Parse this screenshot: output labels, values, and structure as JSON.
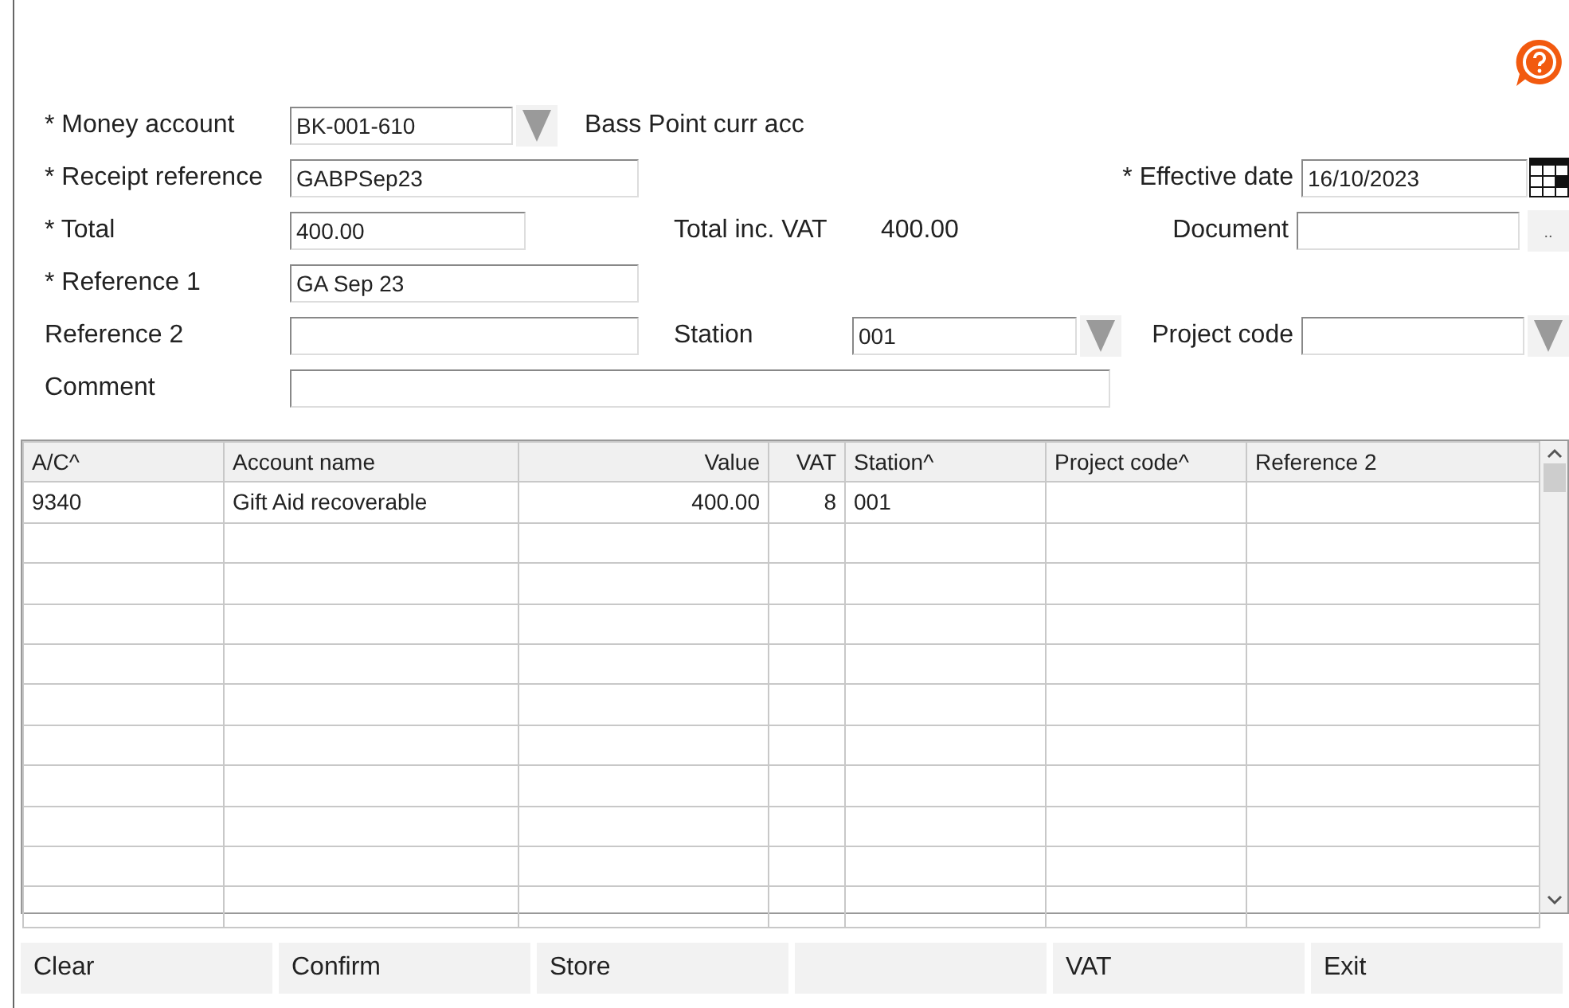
{
  "form": {
    "money_account": {
      "label": "* Money account",
      "value": "BK-001-610",
      "description": "Bass Point curr acc"
    },
    "receipt_reference": {
      "label": "* Receipt reference",
      "value": "GABPSep23"
    },
    "effective_date": {
      "label": "* Effective date",
      "value": "16/10/2023"
    },
    "total": {
      "label": "* Total",
      "value": "400.00"
    },
    "total_inc_vat": {
      "label": "Total inc. VAT",
      "value": "400.00"
    },
    "document": {
      "label": "Document",
      "button": ".."
    },
    "reference_1": {
      "label": "* Reference 1",
      "value": "GA Sep 23"
    },
    "reference_2": {
      "label": "Reference 2"
    },
    "station": {
      "label": "Station",
      "value": "001"
    },
    "project_code": {
      "label": "Project code"
    },
    "comment": {
      "label": "Comment"
    }
  },
  "table": {
    "columns": [
      "A/C^",
      "Account name",
      "Value",
      "VAT",
      "Station^",
      "Project code^",
      "Reference 2"
    ],
    "rows": [
      [
        "9340",
        "Gift Aid recoverable",
        "400.00",
        "8",
        "001"
      ]
    ]
  },
  "buttons": [
    {
      "kind": "text",
      "label": "Clear"
    },
    {
      "kind": "text",
      "label": "Confirm"
    },
    {
      "kind": "text",
      "label": "Store"
    },
    {
      "kind": "blank"
    },
    {
      "kind": "text",
      "label": "VAT"
    },
    {
      "kind": "text",
      "label": "Exit"
    }
  ]
}
